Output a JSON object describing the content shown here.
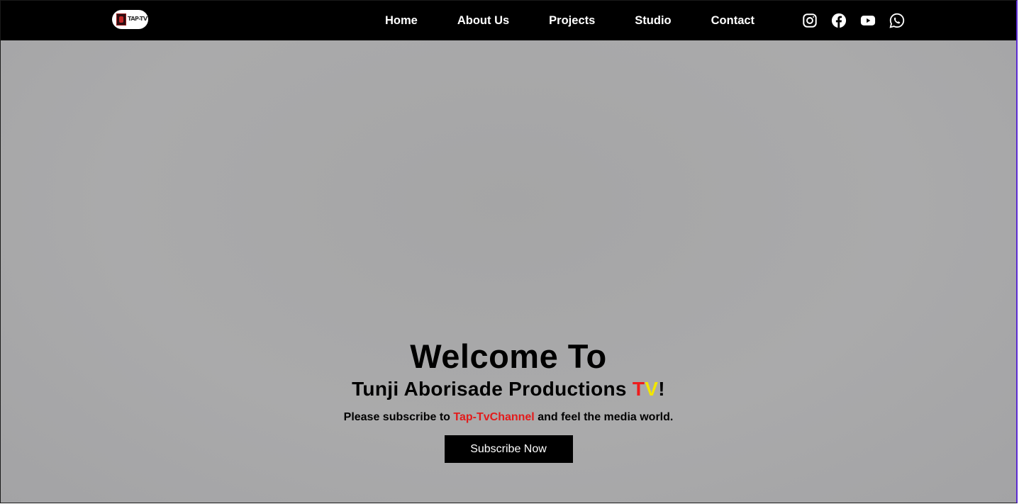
{
  "navbar": {
    "logo": {
      "icon": "tap-tv-logo",
      "text": "TAP-TV"
    },
    "links": [
      {
        "label": "Home"
      },
      {
        "label": "About Us"
      },
      {
        "label": "Projects"
      },
      {
        "label": "Studio"
      },
      {
        "label": "Contact"
      }
    ],
    "socials": [
      {
        "icon": "instagram-icon"
      },
      {
        "icon": "facebook-icon"
      },
      {
        "icon": "youtube-icon"
      },
      {
        "icon": "whatsapp-icon"
      }
    ]
  },
  "hero": {
    "welcome": "Welcome To",
    "company_prefix": "Tunji Aborisade Productions ",
    "company_t": "T",
    "company_v": "V",
    "company_suffix": "!",
    "tagline_prefix": "Please subscribe to ",
    "tagline_channel": "Tap-TvChannel",
    "tagline_suffix": " and feel the media world.",
    "subscribe_label": "Subscribe Now"
  },
  "colors": {
    "navbar_bg": "#000000",
    "hero_bg": "#a9a9ab",
    "accent_red": "#ee1c1c",
    "accent_yellow": "#f2e600",
    "button_bg": "#000000"
  }
}
